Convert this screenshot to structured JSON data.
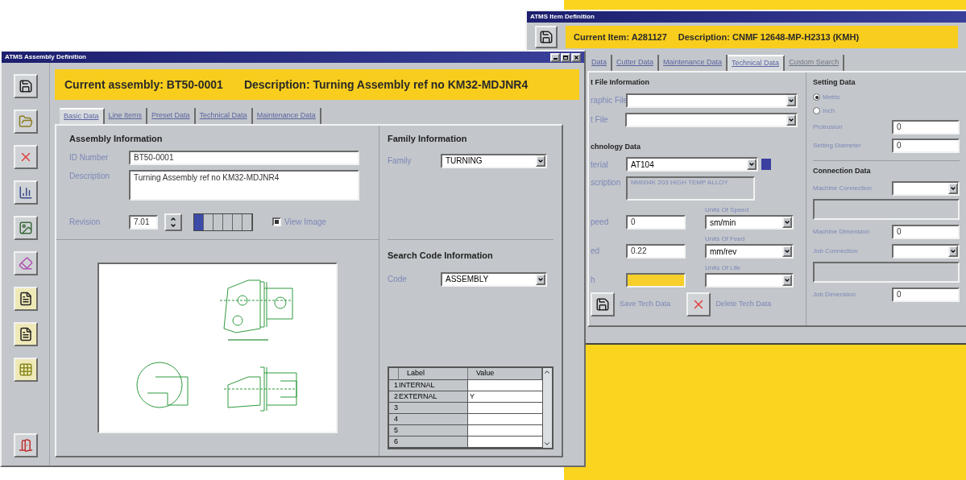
{
  "item_window": {
    "title": "ATMS Item Definition",
    "header": {
      "item": "Current Item: A281127",
      "description": "Description: CNMF 12648-MP-H2313 (KMH)"
    },
    "tabs": [
      {
        "label": "Data",
        "selected": false,
        "disabled": false
      },
      {
        "label": "Cutter Data",
        "selected": false,
        "disabled": false
      },
      {
        "label": "Maintenance Data",
        "selected": false,
        "disabled": false
      },
      {
        "label": "Technical Data",
        "selected": true,
        "disabled": false
      },
      {
        "label": "Custom Search",
        "selected": false,
        "disabled": true
      }
    ],
    "file_section": {
      "title": "t File Information",
      "fields": [
        {
          "label": "raphic File"
        },
        {
          "label": "t File"
        }
      ]
    },
    "technology_section": {
      "title": "chnology Data",
      "material": {
        "label": "terial",
        "value": "AT104"
      },
      "description": {
        "label": "scription",
        "value": "NM004K 203 HIGH TEMP ALLOY"
      },
      "rows": [
        {
          "label": "peed",
          "value": "0",
          "highlighted": false,
          "unit_label": "Units Of Speed",
          "unit_value": "sm/min"
        },
        {
          "label": "ed",
          "value": "0.22",
          "highlighted": false,
          "unit_label": "Units Of Feed",
          "unit_value": "mm/rev"
        },
        {
          "label": "h",
          "highlighted": true,
          "unit_label": "Units Of Life"
        }
      ],
      "buttons": [
        {
          "kind": "save",
          "label": "Save Tech Data"
        },
        {
          "kind": "delete",
          "label": "Delete Tech Data"
        }
      ]
    },
    "setting_section": {
      "title": "Setting Data",
      "units": [
        {
          "label": "Metric",
          "selected": true
        },
        {
          "label": "Inch",
          "selected": false
        }
      ],
      "fields": [
        {
          "label": "Protrusion",
          "value": "0"
        },
        {
          "label": "Setting Diameter",
          "value": "0"
        }
      ]
    },
    "connection_section": {
      "title": "Connection Data",
      "fields": [
        {
          "label": "Machine Connection",
          "kind": "dropdown"
        },
        {
          "label": "Machine Dimension",
          "kind": "number",
          "value": "0"
        },
        {
          "label": "Job Connection",
          "kind": "dropdown"
        },
        {
          "label": "Job Dimension",
          "kind": "number",
          "value": "0"
        }
      ]
    }
  },
  "assembly_window": {
    "title": "ATMS Assembly Definition",
    "header": {
      "assembly": "Current assembly: BT50-0001",
      "description": "Description: Turning Assembly ref no KM32-MDJNR4"
    },
    "toolbar": [
      {
        "kind": "save"
      },
      {
        "kind": "open"
      },
      {
        "kind": "delete"
      },
      {
        "kind": "chart"
      },
      {
        "kind": "image"
      },
      {
        "kind": "eraser"
      },
      {
        "kind": "document"
      },
      {
        "kind": "document"
      },
      {
        "kind": "grid"
      },
      {
        "kind": "exit"
      }
    ],
    "tabs": [
      {
        "label": "Basic Data",
        "selected": true
      },
      {
        "label": "Line Items",
        "selected": false
      },
      {
        "label": "Preset Data",
        "selected": false
      },
      {
        "label": "Technical Data",
        "selected": false
      },
      {
        "label": "Maintenance Data",
        "selected": false
      }
    ],
    "assembly_info": {
      "title": "Assembly Information",
      "id_number": {
        "label": "ID Number",
        "value": "BT50-0001"
      },
      "description": {
        "label": "Description",
        "value": "Turning Assembly ref no KM32-MDJNR4"
      },
      "revision": {
        "label": "Revision",
        "value": "7.01"
      },
      "page_indicator": [
        {
          "selected": true
        },
        {
          "selected": false
        },
        {
          "selected": false
        },
        {
          "selected": false
        },
        {
          "selected": false
        },
        {
          "selected": false
        }
      ],
      "view_image": {
        "label": "View Image",
        "checked": true
      }
    },
    "family": {
      "title": "Family Information",
      "label": "Family",
      "value": "TURNING"
    },
    "search_code": {
      "title": "Search Code Information",
      "label": "Code",
      "value": "ASSEMBLY"
    },
    "label_table": {
      "columns": [
        "Label",
        "Value"
      ],
      "rows": [
        {
          "number": "1",
          "label": "INTERNAL"
        },
        {
          "number": "2",
          "label": "EXTERNAL",
          "value": "Y"
        },
        {
          "number": "3"
        },
        {
          "number": "4"
        },
        {
          "number": "5"
        },
        {
          "number": "6"
        }
      ]
    }
  }
}
